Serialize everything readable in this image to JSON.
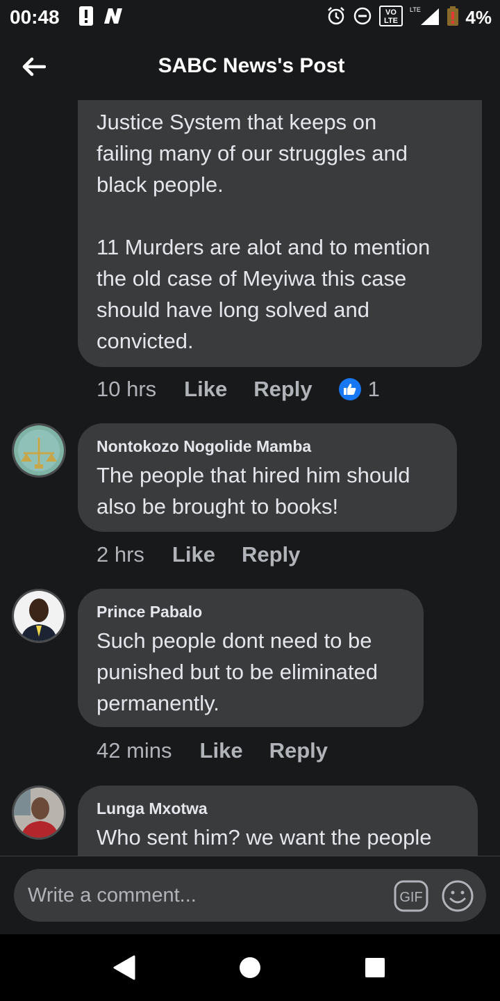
{
  "status_bar": {
    "time": "00:48",
    "volte_label": "VO\nLTE",
    "lte_label": "LTE",
    "battery_percent": "4%"
  },
  "header": {
    "title": "SABC News's Post"
  },
  "comments": [
    {
      "text": "Justice System that keeps on\nfailing many of our struggles and\nblack people.\n\n11 Murders are alot and to mention\nthe old case of Meyiwa this case\nshould have long solved and\nconvicted.",
      "time": "10 hrs",
      "like_label": "Like",
      "reply_label": "Reply",
      "reaction_count": "1"
    },
    {
      "author": "Nontokozo Nogolide Mamba",
      "text": "The people that hired him should\nalso be brought to books!",
      "time": "2 hrs",
      "like_label": "Like",
      "reply_label": "Reply"
    },
    {
      "author": "Prince Pabalo",
      "text": "Such people dont need to be\npunished but to be eliminated\npermanently.",
      "time": "42 mins",
      "like_label": "Like",
      "reply_label": "Reply"
    },
    {
      "author": "Lunga Mxotwa",
      "text": "Who sent him? we want the people"
    }
  ],
  "composer": {
    "placeholder": "Write a comment...",
    "gif_label": "GIF"
  },
  "colors": {
    "background": "#18191a",
    "bubble": "#3a3b3c",
    "text": "#e4e6eb",
    "secondary_text": "#b0b3b8",
    "like_blue": "#1877f2"
  },
  "icons": [
    "back-arrow-icon",
    "alarm-icon",
    "do-not-disturb-icon",
    "signal-icon",
    "battery-icon",
    "like-thumb-icon",
    "gif-icon",
    "emoji-icon",
    "nav-back-icon",
    "nav-home-icon",
    "nav-recents-icon"
  ]
}
